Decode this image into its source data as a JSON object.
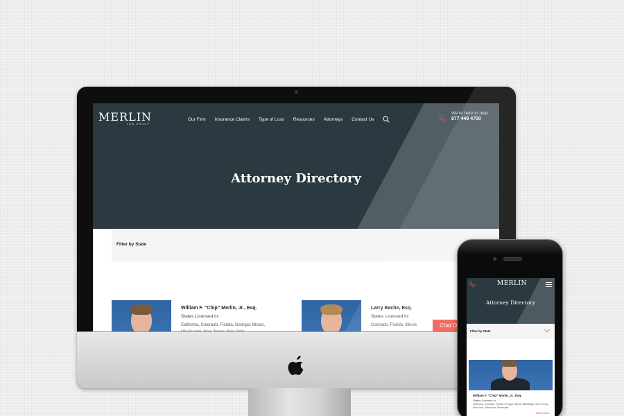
{
  "desktop": {
    "logo": {
      "main": "MERLIN",
      "sub": "LAW GROUP"
    },
    "nav": [
      "Our Firm",
      "Insurance Claims",
      "Type of Loss",
      "Resources",
      "Attorneys",
      "Contact Us"
    ],
    "help": {
      "line1": "We're here to help.",
      "phone": "877 449 4700"
    },
    "hero_title": "Attorney Directory",
    "filter_label": "Filter by State",
    "attorneys": [
      {
        "name": "William F. “Chip” Merlin, Jr., Esq.",
        "states_label": "States Licensed In:",
        "states": "California, Colorado, Florida, Georgia, Illinois, Mississippi, New Jersey, New York"
      },
      {
        "name": "Larry Bache, Esq.",
        "states_label": "States Licensed In:",
        "states": "Colorado, Florida, Illinois"
      }
    ],
    "chat_label": "Chat Offline"
  },
  "mobile": {
    "logo": "MERLIN",
    "hero_title": "Attorney Directory",
    "filter_label": "Filter by State",
    "attorney": {
      "name": "William F. “Chip” Merlin, Jr., Esq.",
      "states_label": "States Licensed In:",
      "states": "California, Colorado, Florida, Georgia, Illinois, Mississippi, New Jersey, New York, Oklahoma, Tennessee",
      "more": "Read More"
    }
  },
  "colors": {
    "hero_bg": "#2b3a41",
    "photo_bg": "#3c74b4",
    "chat_bg": "#f25c52",
    "accent_phone_icon": "#d9534f"
  },
  "icons": [
    "search-icon",
    "phone-icon",
    "menu-icon",
    "chevron-down-icon",
    "apple-logo-icon"
  ]
}
